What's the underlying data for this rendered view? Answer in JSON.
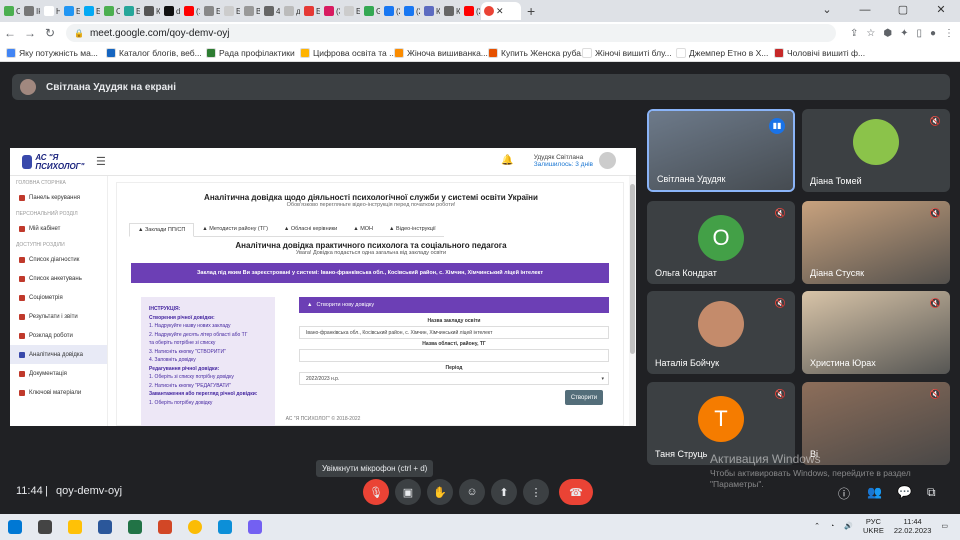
{
  "browser": {
    "tabs": [
      {
        "label": "Сг",
        "color": "#4caf50"
      },
      {
        "label": "Ik Ne",
        "color": "#777"
      },
      {
        "label": "Нє",
        "color": "#fff"
      },
      {
        "label": "Бр",
        "color": "#2196f3"
      },
      {
        "label": "Бр",
        "color": "#03a9f4"
      },
      {
        "label": "Су",
        "color": "#4caf50"
      },
      {
        "label": "Бр",
        "color": "#26a69a"
      },
      {
        "label": "Кс",
        "color": "#555"
      },
      {
        "label": "dk",
        "color": "#111"
      },
      {
        "label": "(1)",
        "color": "#ff0000"
      },
      {
        "label": "Бр",
        "color": "#888"
      },
      {
        "label": "Бр",
        "color": "#ccc"
      },
      {
        "label": "Ві",
        "color": "#999"
      },
      {
        "label": "4(",
        "color": "#666"
      },
      {
        "label": "дк",
        "color": "#bbb"
      },
      {
        "label": "Бр",
        "color": "#e53935"
      },
      {
        "label": "(3)",
        "color": "#d81b60"
      },
      {
        "label": "Бр",
        "color": "#ccc"
      },
      {
        "label": "Gr",
        "color": "#34a853"
      },
      {
        "label": "(2)",
        "color": "#1877f2"
      },
      {
        "label": "(2)",
        "color": "#1877f2"
      },
      {
        "label": "Кс",
        "color": "#5c6bc0"
      },
      {
        "label": "Кс",
        "color": "#666"
      },
      {
        "label": "(2)",
        "color": "#ff0000"
      }
    ],
    "active_tab": {
      "label": "",
      "color": "#ea4335"
    },
    "new_tab": "+",
    "window_controls": [
      "⌄",
      "—",
      "▢",
      "✕"
    ],
    "url": "meet.google.com/qoy-demv-oyj",
    "bookmarks": [
      {
        "label": "Яку потужність ма...",
        "color": "#4285f4"
      },
      {
        "label": "Каталог блогів, веб...",
        "color": "#1565c0"
      },
      {
        "label": "Рада профілактики",
        "color": "#2e7d32"
      },
      {
        "label": "Цифрова освіта та ...",
        "color": "#ffb300"
      },
      {
        "label": "Жіноча вишиванка...",
        "color": "#fb8c00"
      },
      {
        "label": "Купить Женска руба...",
        "color": "#e65100"
      },
      {
        "label": "Жіночі вишиті блу...",
        "color": "#fff"
      },
      {
        "label": "Джемпер Етно в Х...",
        "color": "#fff"
      },
      {
        "label": "Чоловічі вишиті ф...",
        "color": "#c62828"
      }
    ]
  },
  "meet": {
    "presenter_banner": "Світлана Удудяк на екрані",
    "shared": {
      "logo": "АС \"Я ПСИХОЛОГ\"",
      "user_name": "Удудяк Світлана",
      "user_sub": "Залишилось: 3 днів",
      "sidebar": {
        "sections": [
          "Головна сторінка",
          "Персональний розділ",
          "Доступні розділи"
        ],
        "items": [
          "Панель керування",
          "Мій кабінет",
          "Список діагностик",
          "Список анкетувань",
          "Соціометрія",
          "Результати і звіти",
          "Розклад роботи",
          "Аналітична довідка",
          "Документація",
          "Ключові матеріали"
        ]
      },
      "title": "Аналітична довідка щодо діяльності психологічної служби у системі освіти України",
      "subtitle": "Обов'язково перегляньте відео-інструкція перед початком роботи!",
      "tabs": [
        "Заклади ПП/СП",
        "Методисти району (ТГ)",
        "Обласні керівники",
        "МОН",
        "Відео-інструкції"
      ],
      "title2": "Аналітична довідка практичного психолога та соціального педагога",
      "subtitle2": "Увага! Довідка подається одна загальна від закладу освіти",
      "banner": "Заклад під яким Ви зареєстровані у системі: Івано-франківська обл., Косівський район, с. Хімчин, Хімчинський ліцей інтелект",
      "instructions": [
        {
          "t": "ІНСТРУКЦІЯ:",
          "h": true
        },
        {
          "t": "Створення річної довідки:",
          "h": true
        },
        {
          "t": "1. Надрукуйте назву нових закладу",
          "h": false
        },
        {
          "t": "2. Надрукуйте десять літер області або ТГ",
          "h": false
        },
        {
          "t": "   та оберіть потрібне зі списку",
          "h": false
        },
        {
          "t": "3. Натисніть кнопку \"СТВОРИТИ\"",
          "h": false
        },
        {
          "t": "4. Заповніть довідку",
          "h": false
        },
        {
          "t": "Редагування річної довідки:",
          "h": true
        },
        {
          "t": "1. Оберіть зі списку потрібну довідку",
          "h": false
        },
        {
          "t": "2. Натисніть кнопку \"РЕДАГУВАТИ\"",
          "h": false
        },
        {
          "t": "Завантаження або перегляд річної довідки:",
          "h": true
        },
        {
          "t": "1. Оберіть потрібну довідку",
          "h": false
        }
      ],
      "form": {
        "header": "Створити нову довідку",
        "label1": "Назва закладу освіти",
        "value1": "Івано-франківська обл., Косівський район, с. Хімчин, Хімчинський ліцей інтелект",
        "label2": "Назва області, району, ТГ",
        "value2": "",
        "label3": "Період",
        "value3": "2022/2023 н.р.",
        "button": "Створити"
      },
      "footer": "АС \"Я ПСИХОЛОГ\" © 2018-2022"
    },
    "participants": [
      {
        "name": "Світлана Удудяк",
        "kind": "video",
        "color": "#6d7a8a"
      },
      {
        "name": "Діана Томей",
        "kind": "photo",
        "color": "#8bc34a"
      },
      {
        "name": "Ольга Кондрат",
        "kind": "initial",
        "initial": "О",
        "color": "#43a047"
      },
      {
        "name": "Діана Стусяк",
        "kind": "video",
        "color": "#c8a27e"
      },
      {
        "name": "Наталія Бойчук",
        "kind": "photo",
        "color": "#c48b6b"
      },
      {
        "name": "Христина Юрах",
        "kind": "video",
        "color": "#d8c4a8"
      },
      {
        "name": "Таня Струць",
        "kind": "initial",
        "initial": "Т",
        "color": "#f57c00"
      },
      {
        "name": "Ві",
        "kind": "video",
        "color": "#8d6e5a"
      }
    ],
    "tooltip": "Увімкнути мікрофон (ctrl + d)",
    "time": "11:44",
    "separator": "|",
    "meeting_code": "qoy-demv-oyj",
    "watermark_title": "Активация Windows",
    "watermark_text": "Чтобы активировать Windows, перейдите в раздел \"Параметры\"."
  },
  "taskbar": {
    "apps": [
      {
        "name": "windows-start",
        "color": "#0078d4"
      },
      {
        "name": "search",
        "color": "#444"
      },
      {
        "name": "file-explorer",
        "color": "#ffc107"
      },
      {
        "name": "word",
        "color": "#2b579a"
      },
      {
        "name": "excel",
        "color": "#217346"
      },
      {
        "name": "powerpoint",
        "color": "#d24726"
      },
      {
        "name": "chrome",
        "color": "#fbbc05"
      },
      {
        "name": "edge",
        "color": "#0c8fd8"
      },
      {
        "name": "viber",
        "color": "#7360f2"
      }
    ],
    "lang": "РУС",
    "lang2": "UKRE",
    "time": "11:44",
    "date": "22.02.2023"
  }
}
